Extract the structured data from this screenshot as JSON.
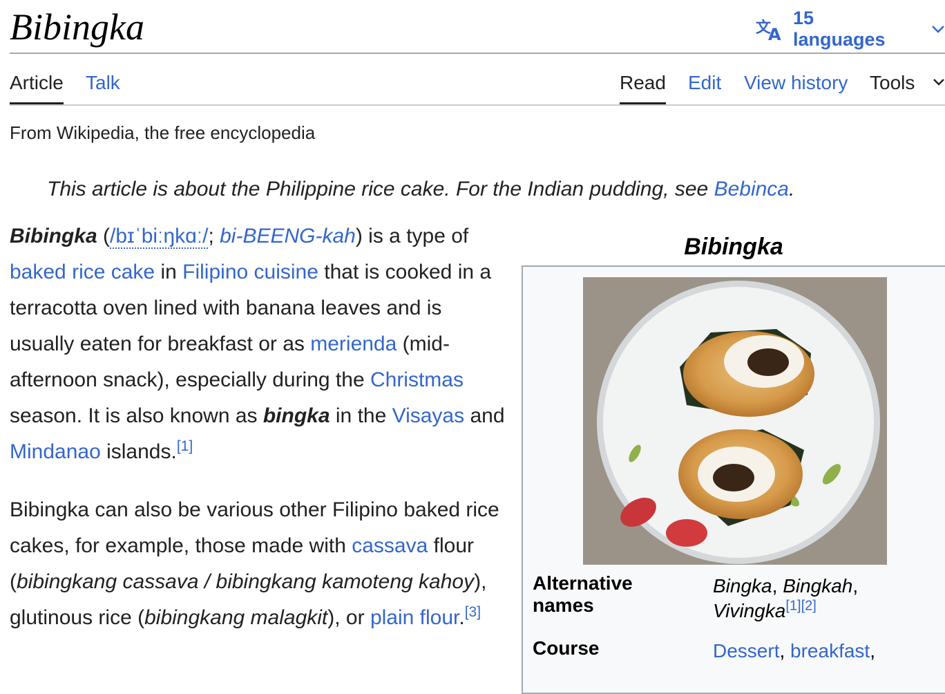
{
  "title": "Bibingka",
  "languages": {
    "label": "15 languages"
  },
  "tabs": {
    "article": "Article",
    "talk": "Talk",
    "read": "Read",
    "edit": "Edit",
    "view_history": "View history",
    "tools": "Tools"
  },
  "tagline": "From Wikipedia, the free encyclopedia",
  "hatnote": {
    "text": "This article is about the Philippine rice cake. For the Indian pudding, see ",
    "link": "Bebinca",
    "end": "."
  },
  "para1": {
    "term": "Bibingka",
    "open": " (",
    "ipa": "/bɪˈbiːŋkɑː/",
    "sep": "; ",
    "respell": "bi-BEENG-kah",
    "close": ") is a type of ",
    "link_baked": "baked rice cake",
    "t_in": " in ",
    "link_filipino": "Filipino cuisine",
    "t_cooked": " that is cooked in a terracotta oven lined with banana leaves and is usually eaten for breakfast or as ",
    "link_merienda": "merienda",
    "t_snack": " (mid-afternoon snack), especially during the ",
    "link_christmas": "Christmas",
    "t_season": " season. It is also known as ",
    "bingka": "bingka",
    "t_inthe": " in the ",
    "link_visayas": "Visayas",
    "t_and": " and ",
    "link_mindanao": "Mindanao",
    "t_islands": " islands.",
    "ref1": "[1]"
  },
  "para2": {
    "t_start": "Bibingka can also be various other Filipino baked rice cakes, for example, those made with ",
    "link_cassava": "cassava",
    "t_flour": " flour (",
    "i_cassava": "bibingkang cassava / bibingkang kamoteng kahoy",
    "t_glut": "), glutinous rice (",
    "i_malagkit": "bibingkang malagkit",
    "t_or": "), or ",
    "link_plain": "plain flour",
    "t_dot": ".",
    "ref3": "[3]"
  },
  "infobox": {
    "caption": "Bibingka",
    "alt_label_1": "Alternative",
    "alt_label_2": "names",
    "alt_v1": "Bingka",
    "alt_sep1": ", ",
    "alt_v2": "Bingkah",
    "alt_sep2": ",",
    "alt_v3": "Vivingka",
    "alt_refs": "[1][2]",
    "course_label": "Course",
    "course_v1": "Dessert",
    "course_sep": ", ",
    "course_v2": "breakfast",
    "course_end": ","
  },
  "colors": {
    "link": "#3366cc",
    "text": "#202122",
    "border": "#a2a9b1",
    "infobox_bg": "#f8f9fa"
  },
  "icons": {
    "language": "translate-icon",
    "chevron": "chevron-down-icon"
  }
}
